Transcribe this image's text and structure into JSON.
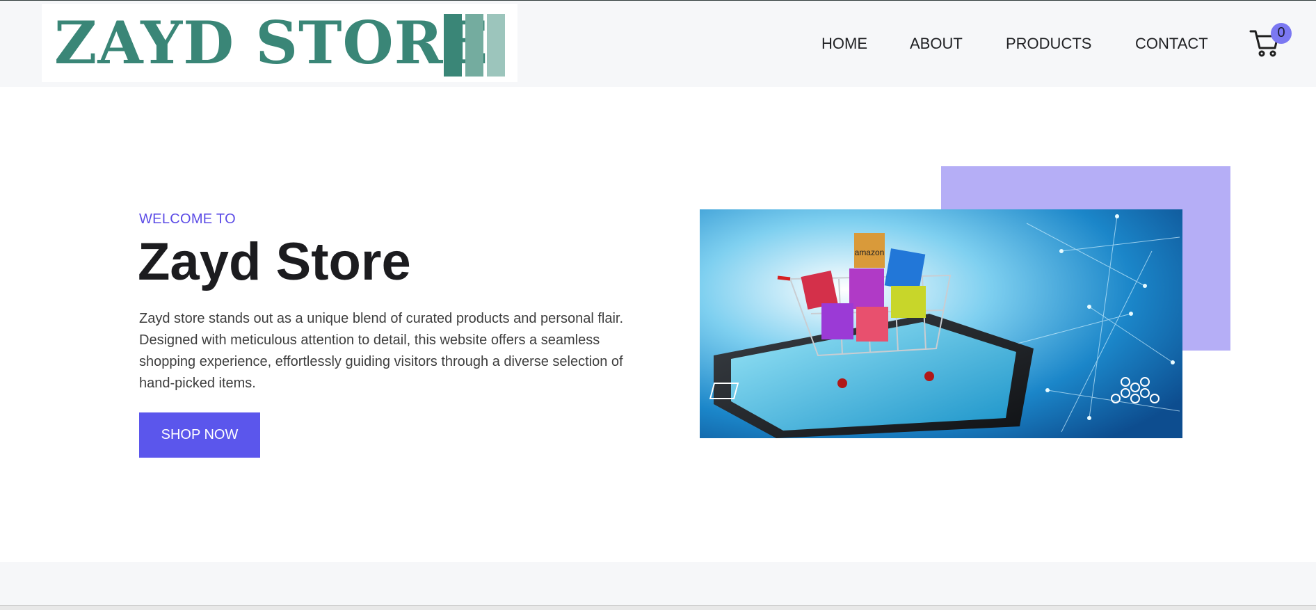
{
  "header": {
    "logo_text": "ZAYD STORE",
    "nav": {
      "home": "HOME",
      "about": "ABOUT",
      "products": "PRODUCTS",
      "contact": "CONTACT"
    },
    "cart_count": "0",
    "cart_icon": "shopping-cart-icon"
  },
  "hero": {
    "eyebrow": "WELCOME TO",
    "title": "Zayd Store",
    "description": "Zayd store stands out as a unique blend of curated products and personal flair. Designed with meticulous attention to detail, this website offers a seamless shopping experience, effortlessly guiding visitors through a diverse selection of hand-picked items.",
    "cta_label": "SHOP NOW",
    "image_labels": {
      "box": "amazon"
    }
  },
  "colors": {
    "accent": "#5b56ec",
    "accent_light": "#b5aef6",
    "logo_green": "#3a8677",
    "header_bg": "#f6f7f9"
  }
}
